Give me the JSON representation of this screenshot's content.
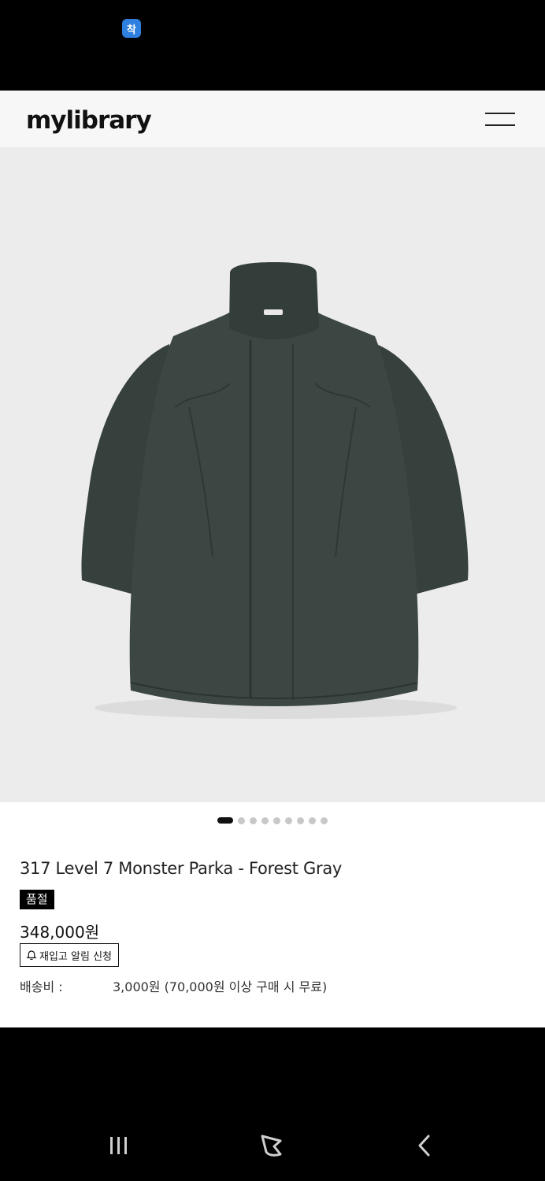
{
  "status_bar": {
    "app_icon_glyph": "착"
  },
  "header": {
    "logo": "mylibrary"
  },
  "product": {
    "title": "317 Level 7 Monster Parka - Forest Gray",
    "badge": "품절",
    "price": "348,000원",
    "restock_button": "재입고 알림 신청",
    "shipping_label": "배송비 :",
    "shipping_value": "3,000원 (70,000원 이상 구매 시 무료)",
    "image_color": "#3c4743",
    "carousel": {
      "total": 9,
      "active_index": 0
    }
  },
  "icons": {
    "menu": "hamburger-icon",
    "bell": "bell-icon",
    "recents": "recent-apps-icon",
    "home": "home-icon",
    "back": "back-icon"
  }
}
